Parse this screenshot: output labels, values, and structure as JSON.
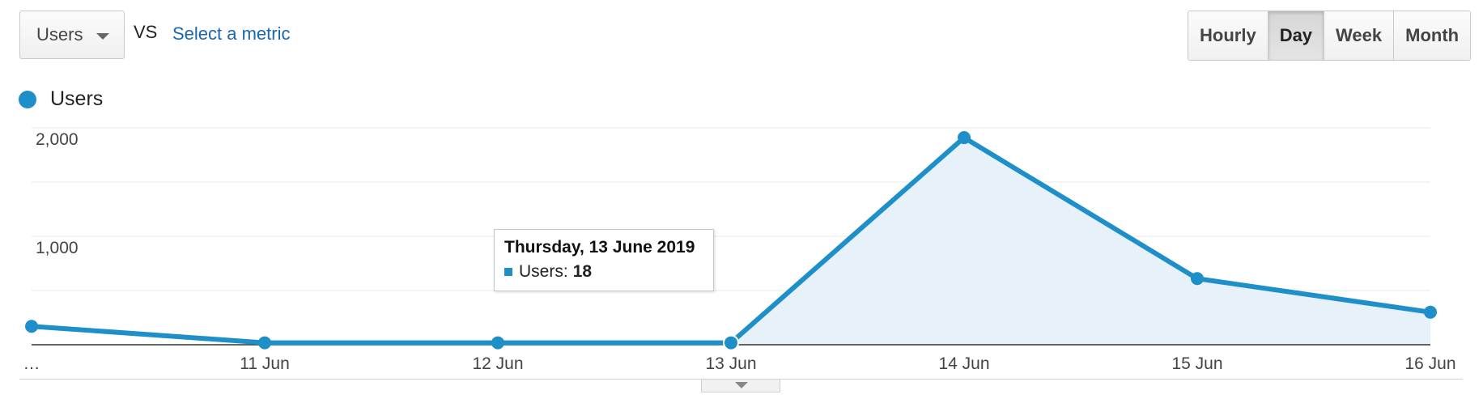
{
  "toolbar": {
    "metric_label": "Users",
    "vs_label": "VS",
    "select_metric_label": "Select a metric",
    "range_buttons": [
      "Hourly",
      "Day",
      "Week",
      "Month"
    ],
    "active_range": "Day"
  },
  "colors": {
    "series": "#1e8fc8",
    "area_fill": "#e6f1f9",
    "link": "#1a66b0",
    "gridline": "#e8e8e8",
    "baseline": "#333333"
  },
  "chart_data": {
    "type": "area",
    "legend": [
      "Users"
    ],
    "categories": [
      "…",
      "11 Jun",
      "12 Jun",
      "13 Jun",
      "14 Jun",
      "15 Jun",
      "16 Jun"
    ],
    "series": [
      {
        "name": "Users",
        "values": [
          170,
          18,
          18,
          18,
          1910,
          610,
          300
        ]
      }
    ],
    "yticks": [
      "2,000",
      "1,000"
    ],
    "ytick_values": [
      2000,
      1000
    ],
    "ylim": [
      0,
      2000
    ],
    "grid": true,
    "legend_position": "top-left",
    "highlight_index": 3,
    "shaded_from_index": 3
  },
  "tooltip": {
    "title": "Thursday, 13 June 2019",
    "series_label": "Users:",
    "value": "18"
  }
}
